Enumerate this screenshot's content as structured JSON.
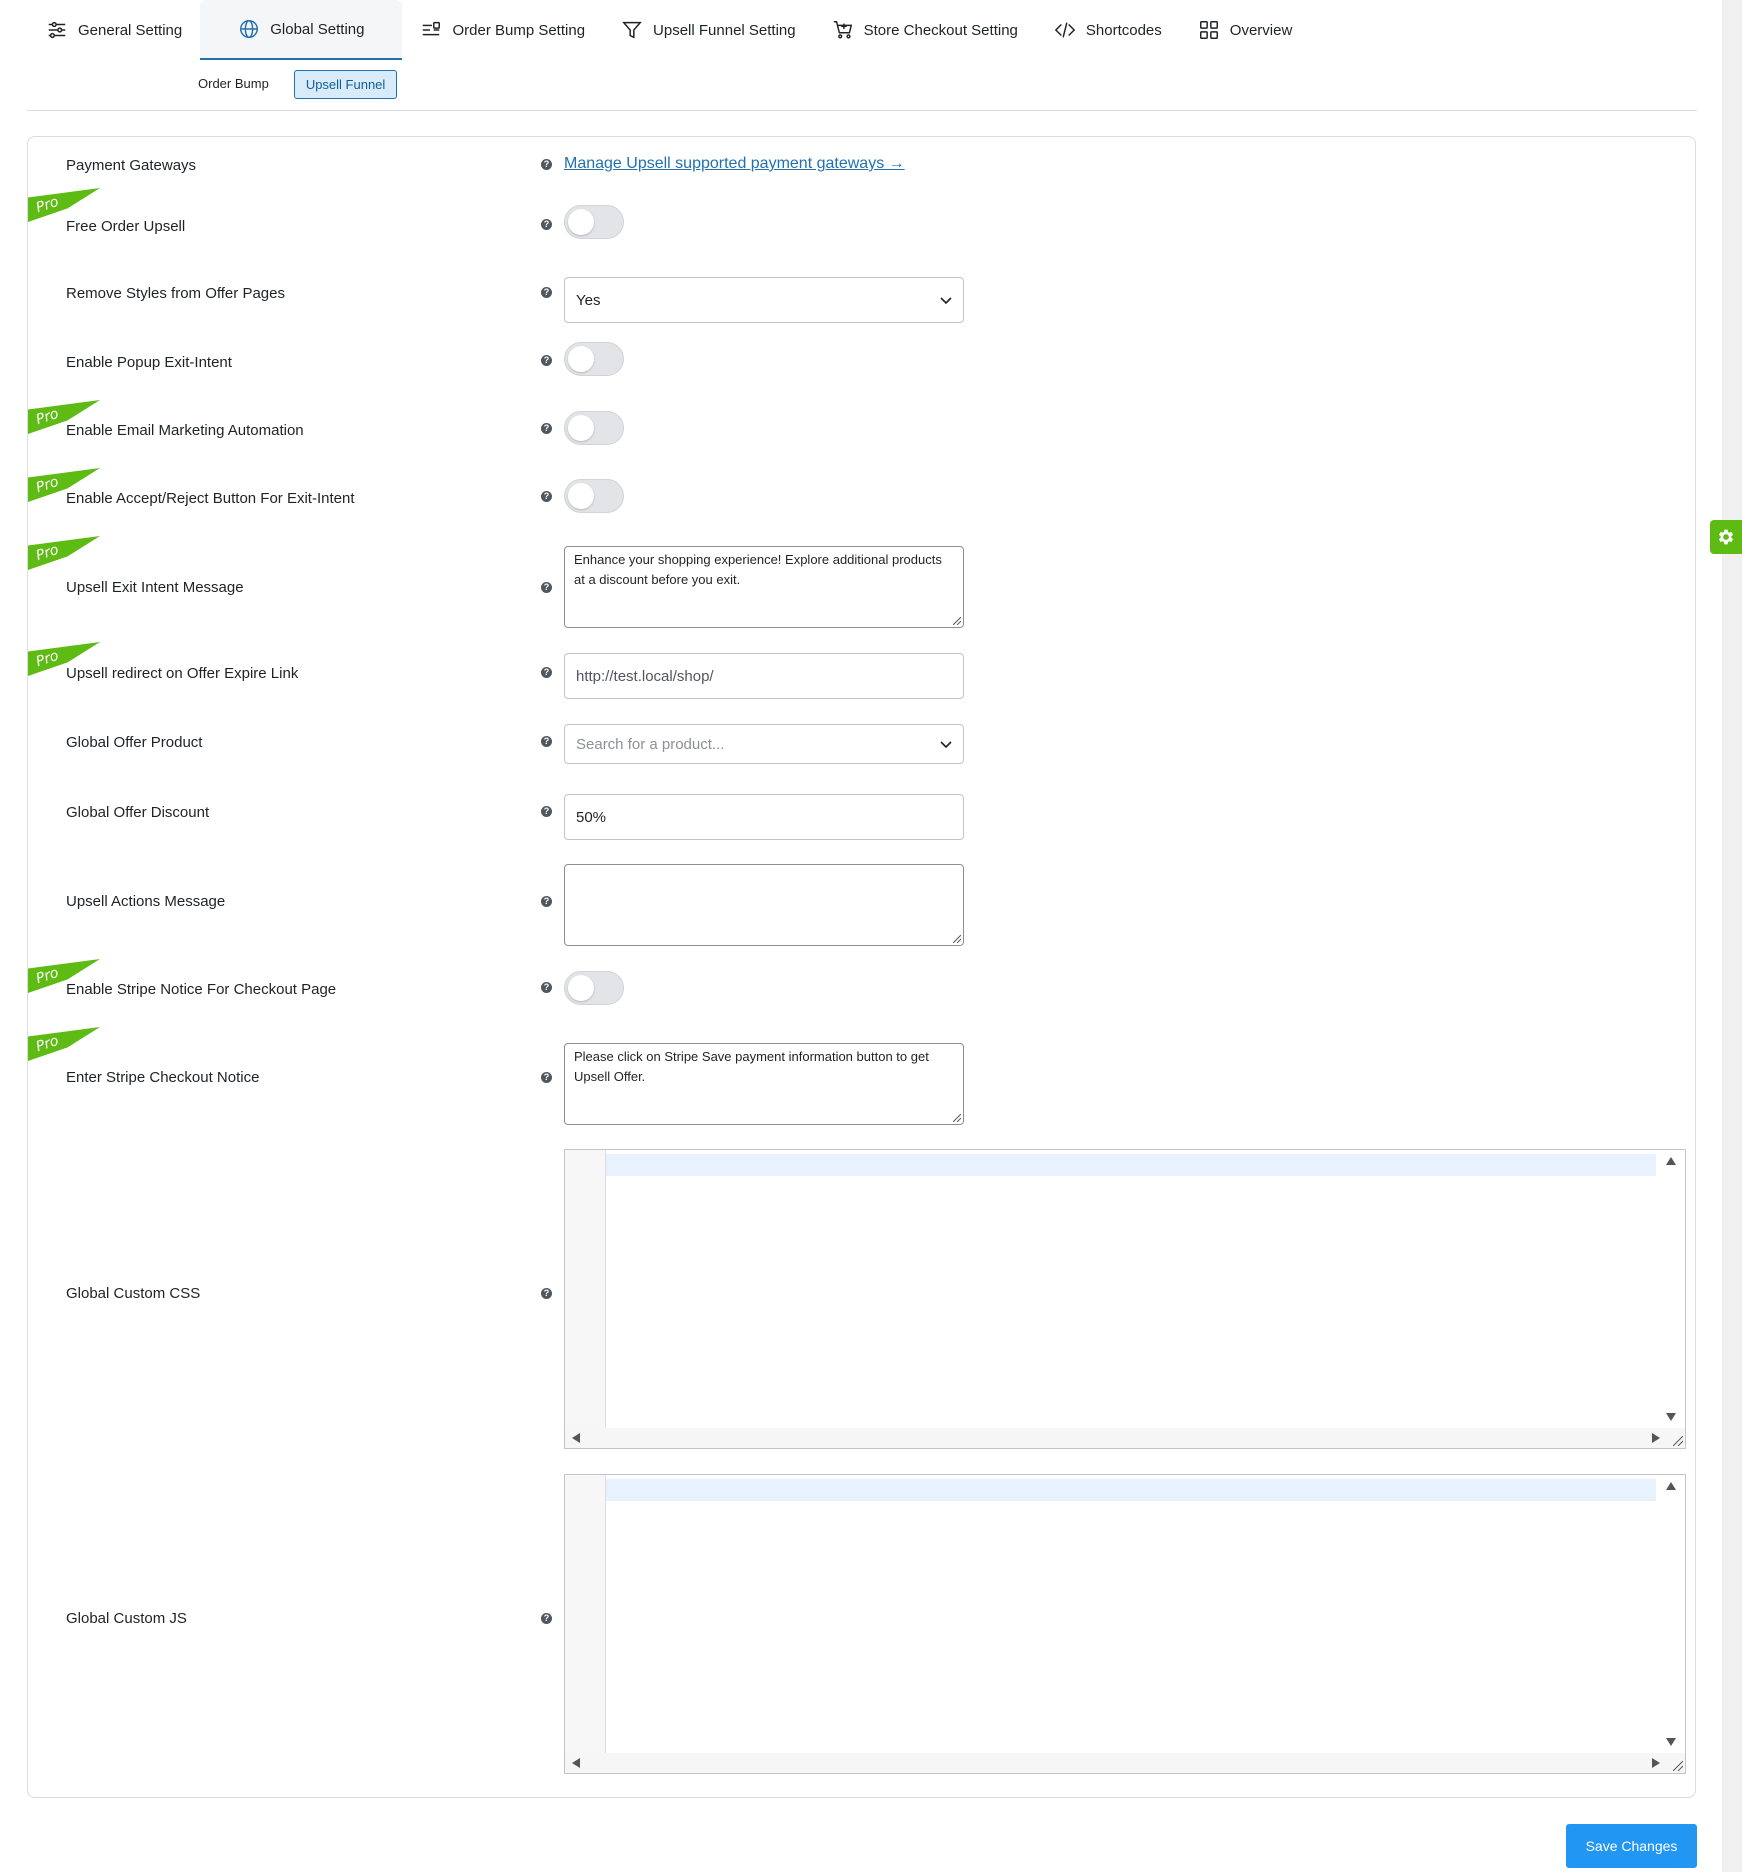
{
  "tabs": [
    {
      "label": "General Setting",
      "icon": "sliders-icon",
      "active": false
    },
    {
      "label": "Global Setting",
      "icon": "globe-icon",
      "active": true
    },
    {
      "label": "Order Bump Setting",
      "icon": "list-settings-icon",
      "active": false
    },
    {
      "label": "Upsell Funnel Setting",
      "icon": "funnel-icon",
      "active": false
    },
    {
      "label": "Store Checkout Setting",
      "icon": "cart-icon",
      "active": false
    },
    {
      "label": "Shortcodes",
      "icon": "code-icon",
      "active": false
    },
    {
      "label": "Overview",
      "icon": "grid-icon",
      "active": false
    }
  ],
  "subtabs": [
    {
      "label": "Order Bump",
      "active": false
    },
    {
      "label": "Upsell Funnel",
      "active": true
    }
  ],
  "pro_badge": "Pro",
  "settings": {
    "payment_gateways": {
      "label": "Payment Gateways",
      "link_text": "Manage Upsell supported payment gateways →"
    },
    "free_order_upsell": {
      "label": "Free Order Upsell",
      "enabled": false,
      "pro": true
    },
    "remove_styles": {
      "label": "Remove Styles from Offer Pages",
      "value": "Yes"
    },
    "popup_exit_intent": {
      "label": "Enable Popup Exit-Intent",
      "enabled": false
    },
    "email_marketing": {
      "label": "Enable Email Marketing Automation",
      "enabled": false,
      "pro": true
    },
    "accept_reject": {
      "label": "Enable Accept/Reject Button For Exit-Intent",
      "enabled": false,
      "pro": true
    },
    "exit_intent_message": {
      "label": "Upsell Exit Intent Message",
      "value": "Enhance your shopping experience! Explore additional products at a discount before you exit.",
      "pro": true
    },
    "offer_expire_link": {
      "label": "Upsell redirect on Offer Expire Link",
      "value": "http://test.local/shop/",
      "pro": true
    },
    "global_offer_product": {
      "label": "Global Offer Product",
      "placeholder": "Search for a product..."
    },
    "global_offer_discount": {
      "label": "Global Offer Discount",
      "value": "50%"
    },
    "actions_message": {
      "label": "Upsell Actions Message",
      "value": ""
    },
    "stripe_notice": {
      "label": "Enable Stripe Notice For Checkout Page",
      "enabled": false,
      "pro": true
    },
    "stripe_checkout_notice": {
      "label": "Enter Stripe Checkout Notice",
      "value": "Please click on Stripe Save payment information button to get Upsell Offer.",
      "pro": true
    },
    "custom_css": {
      "label": "Global Custom CSS",
      "value": ""
    },
    "custom_js": {
      "label": "Global Custom JS",
      "value": ""
    }
  },
  "help_glyph": "?",
  "save_label": "Save Changes",
  "colors": {
    "accent": "#2271b1",
    "pro_green": "#5dbb14",
    "save_blue": "#2196f3"
  }
}
